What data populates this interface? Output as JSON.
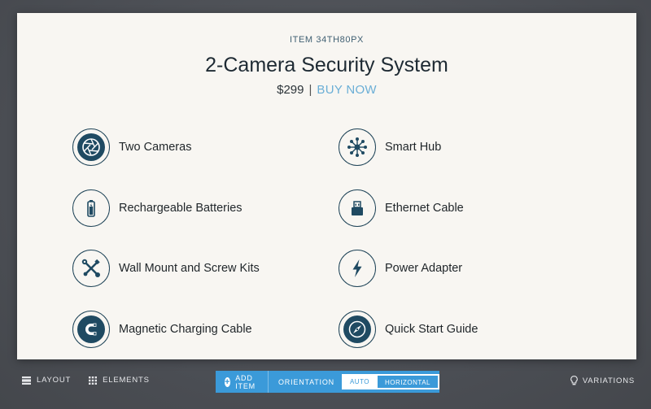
{
  "product": {
    "sku": "ITEM 34TH80PX",
    "title": "2-Camera Security System",
    "price": "$299",
    "separator": "|",
    "buy_label": "BUY NOW"
  },
  "features": [
    {
      "label": "Two Cameras",
      "icon": "camera-aperture-icon"
    },
    {
      "label": "Smart Hub",
      "icon": "hub-network-icon"
    },
    {
      "label": "Rechargeable Batteries",
      "icon": "battery-icon"
    },
    {
      "label": "Ethernet Cable",
      "icon": "ethernet-plug-icon"
    },
    {
      "label": "Wall Mount and Screw Kits",
      "icon": "tools-icon"
    },
    {
      "label": "Power Adapter",
      "icon": "lightning-bolt-icon"
    },
    {
      "label": "Magnetic Charging Cable",
      "icon": "magnet-icon"
    },
    {
      "label": "Quick Start Guide",
      "icon": "compass-icon"
    }
  ],
  "toolbar": {
    "layout_label": "LAYOUT",
    "elements_label": "ELEMENTS",
    "add_item_label": "ADD ITEM",
    "orientation_label": "ORIENTATION",
    "orientation_options": [
      "AUTO",
      "HORIZONTAL"
    ],
    "orientation_selected": "HORIZONTAL",
    "variations_label": "VARIATIONS"
  },
  "colors": {
    "icon_fill": "#1f4a62",
    "accent_blue": "#3b9ad9",
    "buy_link": "#6aaed6",
    "card_bg": "#f8f6f2"
  }
}
